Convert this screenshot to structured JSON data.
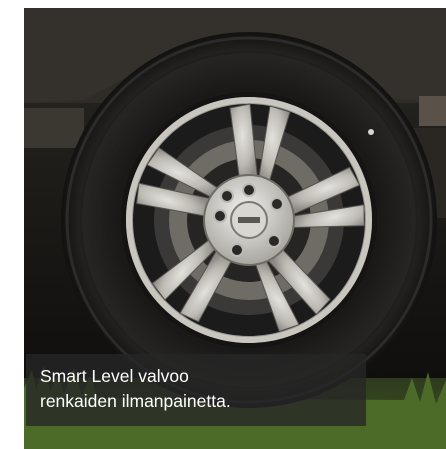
{
  "image": {
    "subject": "tire-wheel-photo",
    "caption_lines": [
      "Smart Level valvoo",
      "renkaiden ilmanpainetta."
    ]
  }
}
